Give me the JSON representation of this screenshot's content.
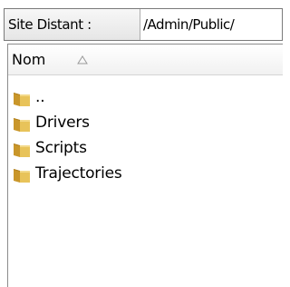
{
  "site_bar": {
    "label": "Site Distant :",
    "path_value": "/Admin/Public/"
  },
  "list": {
    "columns": [
      {
        "label": "Nom",
        "sort_icon": "sort-ascending-icon"
      }
    ],
    "items": [
      {
        "name": "..",
        "icon": "folder-icon"
      },
      {
        "name": "Drivers",
        "icon": "folder-icon"
      },
      {
        "name": "Scripts",
        "icon": "folder-icon"
      },
      {
        "name": "Trajectories",
        "icon": "folder-icon"
      }
    ]
  },
  "colors": {
    "folder_body": "#e8c35a",
    "folder_tab": "#c9962a"
  }
}
